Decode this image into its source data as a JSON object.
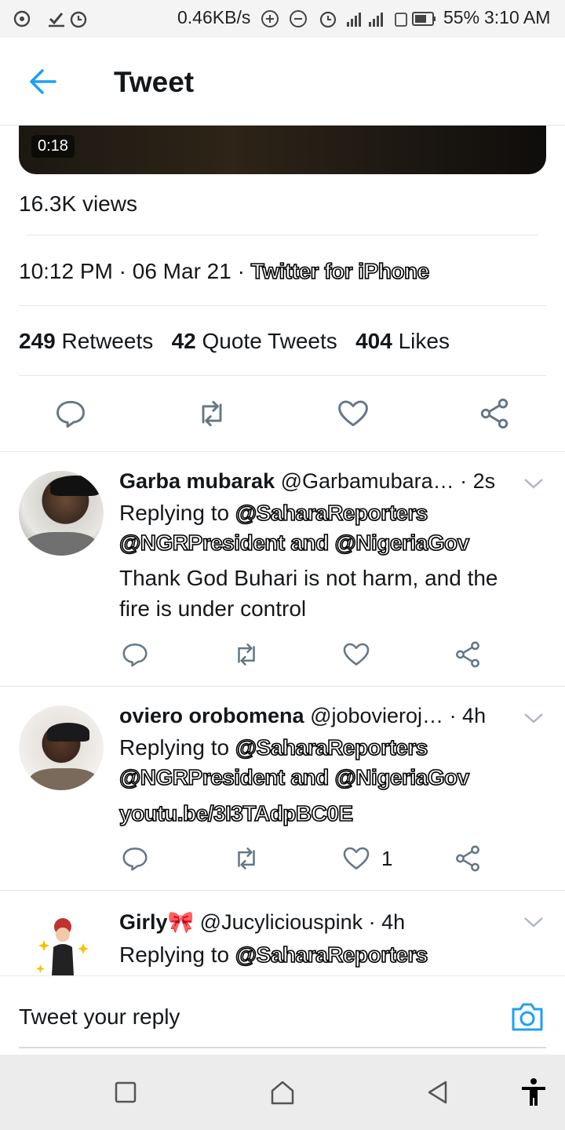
{
  "status_bar": {
    "speed": "0.46KB/s",
    "battery": "55%",
    "time": "3:10 AM"
  },
  "header": {
    "title": "Tweet",
    "back_icon": "arrow-left-icon"
  },
  "tweet": {
    "video_duration": "0:18",
    "views": "16.3K views",
    "time": "10:12 PM",
    "date": "06 Mar 21",
    "source": "Twitter for iPhone",
    "retweets_count": "249",
    "retweets_label": "Retweets",
    "quotes_count": "42",
    "quotes_label": "Quote Tweets",
    "likes_count": "404",
    "likes_label": "Likes"
  },
  "replies": [
    {
      "name": "Garba mubarak",
      "handle": "@Garbamubara…",
      "time": "· 2s",
      "replying_prefix": "Replying to",
      "mention1": "@SaharaReporters",
      "mention2": "@NGRPresident",
      "and": "and",
      "mention3": "@NigeriaGov",
      "text1": "Thank God Buhari is not harm, and the",
      "text2": "fire is under control",
      "like_count": ""
    },
    {
      "name": "oviero orobomena",
      "handle": "@jobovieroj…",
      "time": "· 4h",
      "replying_prefix": "Replying to",
      "mention1": "@SaharaReporters",
      "mention2": "@NGRPresident",
      "and": "and",
      "mention3": "@NigeriaGov",
      "link": "youtu.be/3I3TAdpBC0E",
      "like_count": "1"
    },
    {
      "name": "Girly🎀",
      "handle": "@Jucyliciouspink",
      "time": "· 4h",
      "replying_prefix": "Replying to",
      "mention1": "@SaharaReporters"
    }
  ],
  "compose": {
    "placeholder": "Tweet your reply",
    "camera_icon": "camera-icon"
  },
  "colors": {
    "accent": "#1da1f2",
    "icon_gray": "#657786"
  }
}
